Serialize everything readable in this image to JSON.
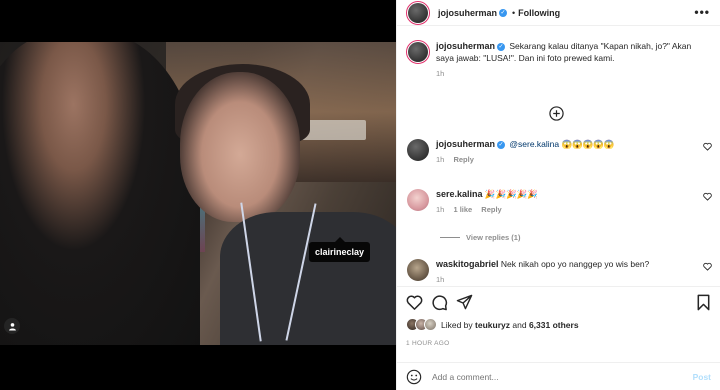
{
  "media": {
    "tag_label": "clairineclay"
  },
  "header": {
    "username": "jojosuherman",
    "separator": "•",
    "follow_state": "Following",
    "more": "•••"
  },
  "caption": {
    "username": "jojosuherman",
    "text": "Sekarang kalau ditanya \"Kapan nikah, jo?\" Akan saya jawab: \"LUSA!\". Dan ini foto prewed kami.",
    "time": "1h"
  },
  "comments": [
    {
      "username": "jojosuherman",
      "mention": "@sere.kalina",
      "text": "😱😱😱😱😱",
      "time": "1h",
      "reply": "Reply"
    },
    {
      "username": "sere.kalina",
      "text": "🎉🎉🎉🎉🎉",
      "time": "1h",
      "likes": "1 like",
      "reply": "Reply",
      "view_replies": "View replies (1)"
    },
    {
      "username": "waskitogabriel",
      "text": "Nek nikah opo yo nanggep yo wis ben?",
      "time": "1h"
    }
  ],
  "likes": {
    "prefix": "Liked by",
    "user": "teukuryz",
    "and": "and",
    "count": "6,331 others"
  },
  "timestamp": "1 HOUR AGO",
  "add_comment": {
    "placeholder": "Add a comment...",
    "post": "Post"
  },
  "colors": {
    "verified": "#3897f0",
    "ring": "#e1306c",
    "post_disabled": "#b2dffc"
  }
}
